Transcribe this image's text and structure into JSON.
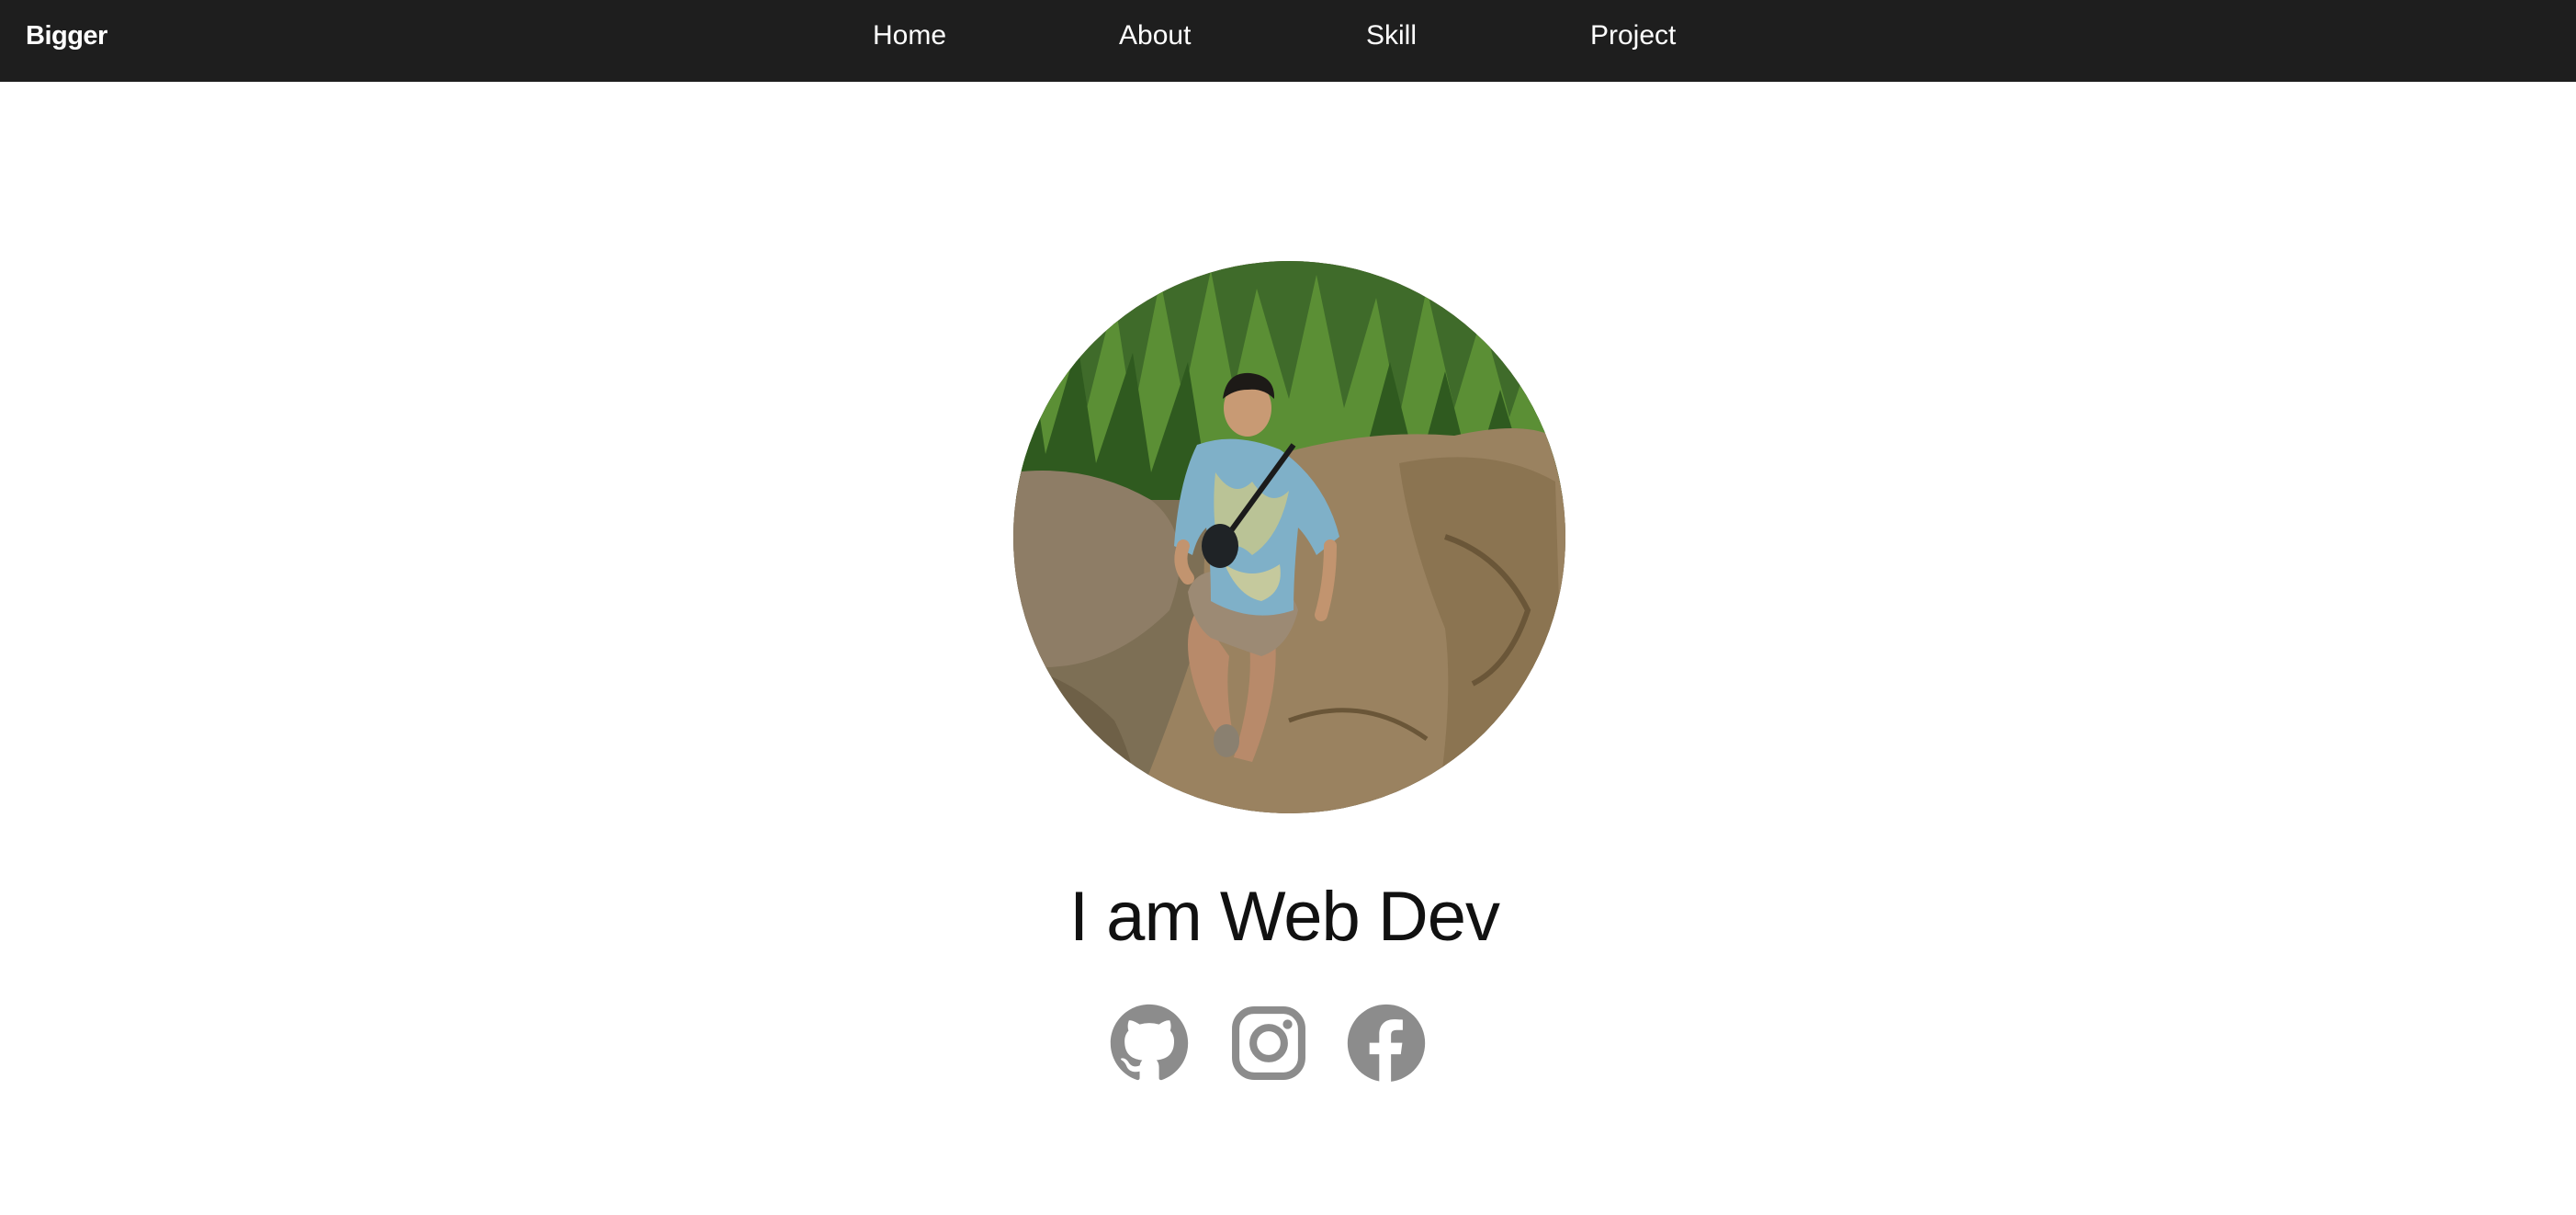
{
  "header": {
    "brand": "Bigger",
    "nav": {
      "home": "Home",
      "about": "About",
      "skill": "Skill",
      "project": "Project"
    }
  },
  "hero": {
    "avatar_icon": "profile-photo",
    "headline": "I am Web Dev"
  },
  "social": {
    "icons": [
      "github-icon",
      "instagram-icon",
      "facebook-icon"
    ],
    "icon_color": "#8c8c8c"
  },
  "colors": {
    "navbar_bg": "#1e1e1e",
    "page_bg": "#ffffff",
    "text_dark": "#111111"
  }
}
